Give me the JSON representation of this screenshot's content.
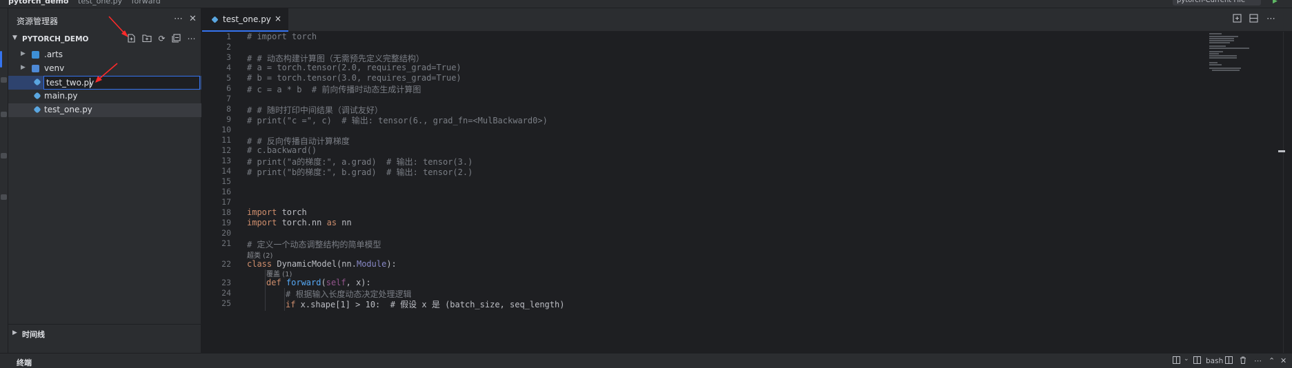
{
  "window": {
    "breadcrumb_project": "pytorch_demo",
    "breadcrumb_file": "test_one.py",
    "breadcrumb_symbol": "forward",
    "run_config": "pytorch-Current File"
  },
  "sidebar": {
    "title": "资源管理器",
    "more_icon": "more-icon",
    "close_icon": "close-icon",
    "project_name": "PYTORCH_DEMO",
    "tree": [
      {
        "label": ".arts",
        "kind": "folder",
        "expandable": true
      },
      {
        "label": "venv",
        "kind": "folder",
        "expandable": true
      },
      {
        "label": "test_two.py",
        "kind": "python-file",
        "state": "renaming"
      },
      {
        "label": "main.py",
        "kind": "python-file"
      },
      {
        "label": "test_one.py",
        "kind": "python-file",
        "state": "current"
      }
    ],
    "timeline_label": "时间线"
  },
  "editor": {
    "tab_label": "test_one.py",
    "tab_close": "×",
    "line_numbers": [
      "1",
      "2",
      "3",
      "4",
      "5",
      "6",
      "7",
      "8",
      "9",
      "10",
      "11",
      "12",
      "13",
      "14",
      "15",
      "16",
      "17",
      "18",
      "19",
      "20",
      "21",
      "22",
      "23",
      "24",
      "25"
    ],
    "lines": {
      "l1": "# import torch",
      "l3": "# # 动态构建计算图（无需预先定义完整结构）",
      "l4": "# a = torch.tensor(2.0, requires_grad=True)",
      "l5": "# b = torch.tensor(3.0, requires_grad=True)",
      "l6": "# c = a * b  # 前向传播时动态生成计算图",
      "l8": "# # 随时打印中间结果（调试友好）",
      "l9": "# print(\"c =\", c)  # 输出: tensor(6., grad_fn=<MulBackward0>)",
      "l11": "# # 反向传播自动计算梯度",
      "l12": "# c.backward()",
      "l13": "# print(\"a的梯度:\", a.grad)  # 输出: tensor(3.)",
      "l14": "# print(\"b的梯度:\", b.grad)  # 输出: tensor(2.)",
      "l18_kw": "import",
      "l18_mod": " torch",
      "l19_kw": "import",
      "l19_mod": " torch.nn ",
      "l19_as": "as",
      "l19_alias": " nn",
      "l21": "# 定义一个动态调整结构的简单模型",
      "inlay_superclass": "超类 (2)",
      "l22_kw": "class",
      "l22_name": " DynamicModel(",
      "l22_base_mod": "nn",
      "l22_dot": ".",
      "l22_base": "Module",
      "l22_end": "):",
      "inlay_override": "覆盖 (1)",
      "l23_kw": "def",
      "l23_fn": " forward",
      "l23_open": "(",
      "l23_self": "self",
      "l23_rest": ", x):",
      "l24": "# 根据输入长度动态决定处理逻辑",
      "l25_kw": "if",
      "l25_rest": " x.shape[1] > 10:  # 假设 x 是 (batch_size, seq_length)"
    }
  },
  "bottom_panel": {
    "title": "终端",
    "shell": "bash"
  },
  "colors": {
    "accent": "#3574f0",
    "comment": "#7a7e85",
    "keyword": "#cf8e6d",
    "function": "#56a8f5",
    "self": "#94558d",
    "annotation_arrow": "#ff2a2a"
  }
}
